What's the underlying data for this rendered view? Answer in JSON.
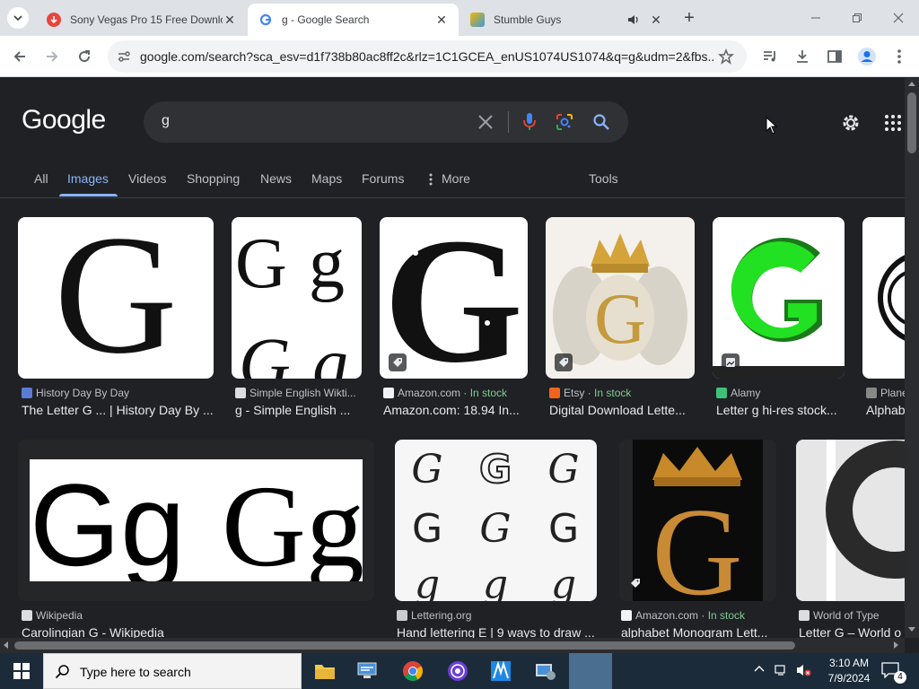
{
  "browser": {
    "tabs": [
      {
        "title": "Sony Vegas Pro 15 Free Downlo",
        "active": false
      },
      {
        "title": "g - Google Search",
        "active": true
      },
      {
        "title": "Stumble Guys",
        "active": false
      }
    ],
    "url": "google.com/search?sca_esv=d1f738b80ac8ff2c&rlz=1C1GCEA_enUS1074US1074&q=g&udm=2&fbs..."
  },
  "google": {
    "logo": "Google",
    "query": "g",
    "nav_tabs": [
      "All",
      "Images",
      "Videos",
      "Shopping",
      "News",
      "Maps",
      "Forums",
      "More"
    ],
    "active_tab": "Images",
    "tools_label": "Tools"
  },
  "results_row1": [
    {
      "source": "History Day By Day",
      "in_stock": "",
      "caption": "The Letter G ... | History Day By ..."
    },
    {
      "source": "Simple English Wikti...",
      "in_stock": "",
      "caption": "g - Simple English ..."
    },
    {
      "source": "Amazon.com",
      "in_stock": "In stock",
      "caption": "Amazon.com: 18.94 In..."
    },
    {
      "source": "Etsy",
      "in_stock": "In stock",
      "caption": "Digital Download Lette..."
    },
    {
      "source": "Alamy",
      "in_stock": "",
      "caption": "Letter g hi-res stock..."
    },
    {
      "source": "Plane",
      "in_stock": "",
      "caption": "Alphab"
    }
  ],
  "results_row2": [
    {
      "source": "Wikipedia",
      "in_stock": "",
      "caption": "Carolingian G - Wikipedia"
    },
    {
      "source": "Lettering.org",
      "in_stock": "",
      "caption": "Hand lettering E | 9 ways to draw ..."
    },
    {
      "source": "Amazon.com",
      "in_stock": "In stock",
      "caption": "alphabet Monogram Lett..."
    },
    {
      "source": "World of Type",
      "in_stock": "",
      "caption": "Letter G – World o"
    }
  ],
  "taskbar": {
    "search_placeholder": "Type here to search",
    "time": "3:10 AM",
    "date": "7/9/2024",
    "notification_count": "4"
  },
  "colors": {
    "page_bg": "#202124",
    "link_blue": "#8ab4f8",
    "in_stock_green": "#81c995",
    "alamy_green": "#22e022",
    "taskbar": "#1b2b3a"
  }
}
